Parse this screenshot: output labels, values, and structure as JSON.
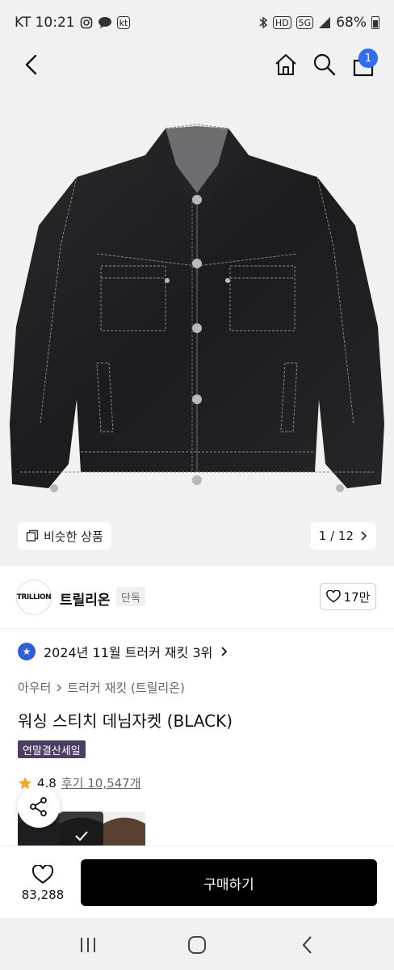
{
  "status_bar": {
    "carrier_time": "KT 10:21",
    "icon_hd": "HD",
    "icon_5g": "5G",
    "battery": "68%"
  },
  "header": {
    "cart_count": "1"
  },
  "hero": {
    "similar_label": "비슷한 상품",
    "page_indicator": "1 / 12"
  },
  "brand": {
    "logo_text": "TRILLION",
    "name": "트릴리온",
    "tag": "단독",
    "likes": "17만"
  },
  "product": {
    "rank_text": "2024년 11월 트러커 재킷 3위",
    "breadcrumb_1": "아우터",
    "breadcrumb_2": "트러커 재킷 (트릴리온)",
    "title": "워싱 스티치 데님자켓 (BLACK)",
    "sale_tag": "연말결산세일",
    "rating": "4.8",
    "reviews": "후기 10,547개"
  },
  "buy_bar": {
    "wish_count": "83,288",
    "buy_label": "구매하기"
  },
  "colors": {
    "accent_blue": "#2f6fed",
    "rank_blue": "#2f5fd8",
    "sale_tag_bg": "#4d3f61",
    "star": "#f5a623",
    "buy_button": "#000000"
  }
}
